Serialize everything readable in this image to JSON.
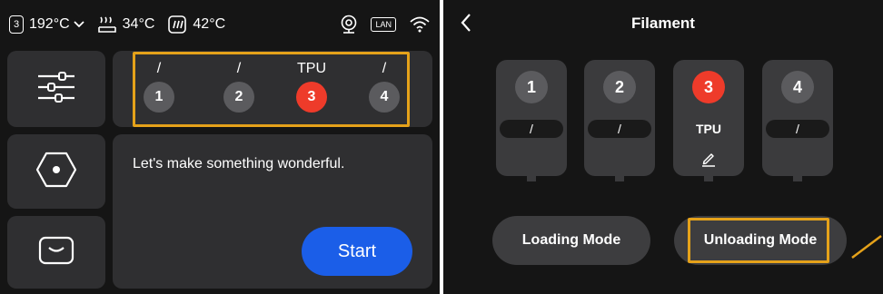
{
  "left_screen": {
    "status": {
      "nozzle_index": "3",
      "nozzle_temp": "192°C",
      "bed_temp": "34°C",
      "chamber_temp": "42°C",
      "lan_label": "LAN"
    },
    "slots": [
      {
        "label": "/",
        "number": "1",
        "active": false
      },
      {
        "label": "/",
        "number": "2",
        "active": false
      },
      {
        "label": "TPU",
        "number": "3",
        "active": true
      },
      {
        "label": "/",
        "number": "4",
        "active": false
      }
    ],
    "message": "Let's make something wonderful.",
    "start_label": "Start"
  },
  "right_screen": {
    "title": "Filament",
    "spools": [
      {
        "number": "1",
        "material": "/",
        "active": false
      },
      {
        "number": "2",
        "material": "/",
        "active": false
      },
      {
        "number": "3",
        "material": "TPU",
        "active": true
      },
      {
        "number": "4",
        "material": "/",
        "active": false
      }
    ],
    "loading_mode_label": "Loading Mode",
    "unloading_mode_label": "Unloading Mode"
  },
  "colors": {
    "accent_red": "#ee3b2a",
    "start_blue": "#1b5ee8",
    "highlight_orange": "#e5a21a"
  }
}
